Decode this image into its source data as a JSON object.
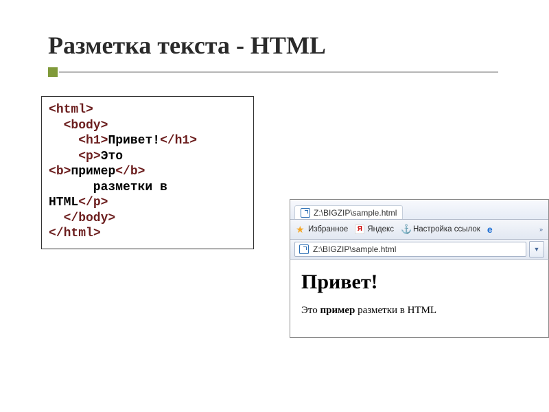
{
  "title": "Разметка текста - HTML",
  "code": {
    "lines": [
      {
        "ind": 0,
        "segs": [
          {
            "t": "<",
            "k": 1
          },
          {
            "t": "html",
            "k": 1
          },
          {
            "t": ">",
            "k": 1
          }
        ]
      },
      {
        "ind": 1,
        "segs": [
          {
            "t": "<",
            "k": 1
          },
          {
            "t": "body",
            "k": 1
          },
          {
            "t": ">",
            "k": 1
          }
        ]
      },
      {
        "ind": 2,
        "segs": [
          {
            "t": "<",
            "k": 1
          },
          {
            "t": "h1",
            "k": 1
          },
          {
            "t": ">",
            "k": 1
          },
          {
            "t": "Привет!",
            "k": 0
          },
          {
            "t": "</",
            "k": 1
          },
          {
            "t": "h1",
            "k": 1
          },
          {
            "t": ">",
            "k": 1
          }
        ]
      },
      {
        "ind": 2,
        "segs": [
          {
            "t": "<",
            "k": 1
          },
          {
            "t": "p",
            "k": 1
          },
          {
            "t": ">",
            "k": 1
          },
          {
            "t": "Это",
            "k": 0
          }
        ]
      },
      {
        "ind": 0,
        "segs": [
          {
            "t": "<",
            "k": 1
          },
          {
            "t": "b",
            "k": 1
          },
          {
            "t": ">",
            "k": 1
          },
          {
            "t": "пример",
            "k": 0
          },
          {
            "t": "</",
            "k": 1
          },
          {
            "t": "b",
            "k": 1
          },
          {
            "t": ">",
            "k": 1
          }
        ]
      },
      {
        "ind": 3,
        "segs": [
          {
            "t": "разметки в",
            "k": 0
          }
        ]
      },
      {
        "ind": 0,
        "segs": [
          {
            "t": "HTML",
            "k": 0
          },
          {
            "t": "</",
            "k": 1
          },
          {
            "t": "p",
            "k": 1
          },
          {
            "t": ">",
            "k": 1
          }
        ]
      },
      {
        "ind": 1,
        "segs": [
          {
            "t": "</",
            "k": 1
          },
          {
            "t": "body",
            "k": 1
          },
          {
            "t": ">",
            "k": 1
          }
        ]
      },
      {
        "ind": 0,
        "segs": [
          {
            "t": "</",
            "k": 1
          },
          {
            "t": "html",
            "k": 1
          },
          {
            "t": ">",
            "k": 1
          }
        ]
      }
    ]
  },
  "browser": {
    "tab_label": "Z:\\BIGZIP\\sample.html",
    "favorites_label": "Избранное",
    "yandex_letter": "Я",
    "yandex_label": "Яндекс",
    "links_label": "Настройка ссылок",
    "address_value": "Z:\\BIGZIP\\sample.html",
    "dropdown_glyph": "▼",
    "chevron_glyph": "»"
  },
  "rendered": {
    "heading": "Привет!",
    "para_prefix": "Это ",
    "para_bold": "пример",
    "para_suffix": " разметки в HTML"
  }
}
